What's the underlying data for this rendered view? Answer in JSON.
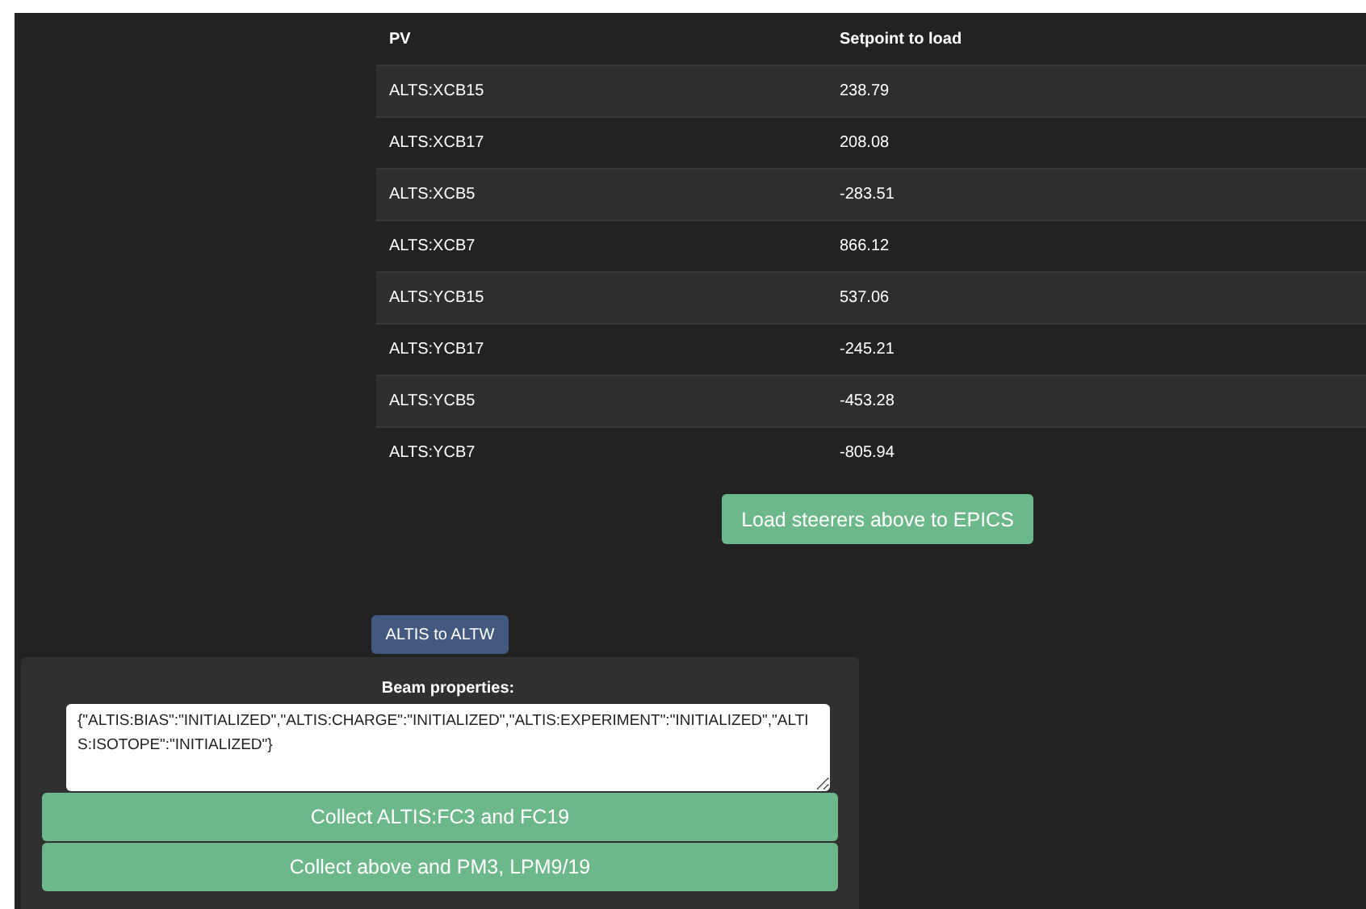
{
  "table": {
    "columns": [
      "PV",
      "Setpoint to load"
    ],
    "rows": [
      [
        "ALTS:XCB15",
        "238.79"
      ],
      [
        "ALTS:XCB17",
        "208.08"
      ],
      [
        "ALTS:XCB5",
        "-283.51"
      ],
      [
        "ALTS:XCB7",
        "866.12"
      ],
      [
        "ALTS:YCB15",
        "537.06"
      ],
      [
        "ALTS:YCB17",
        "-245.21"
      ],
      [
        "ALTS:YCB5",
        "-453.28"
      ],
      [
        "ALTS:YCB7",
        "-805.94"
      ]
    ]
  },
  "load_button": "Load steerers above to EPICS",
  "tab_button": "ALTIS to ALTW",
  "beam": {
    "label": "Beam properties:",
    "value": "{\"ALTIS:BIAS\":\"INITIALIZED\",\"ALTIS:CHARGE\":\"INITIALIZED\",\"ALTIS:EXPERIMENT\":\"INITIALIZED\",\"ALTIS:ISOTOPE\":\"INITIALIZED\"}"
  },
  "actions": [
    "Collect ALTIS:FC3 and FC19",
    "Collect above and PM3, LPM9/19"
  ]
}
